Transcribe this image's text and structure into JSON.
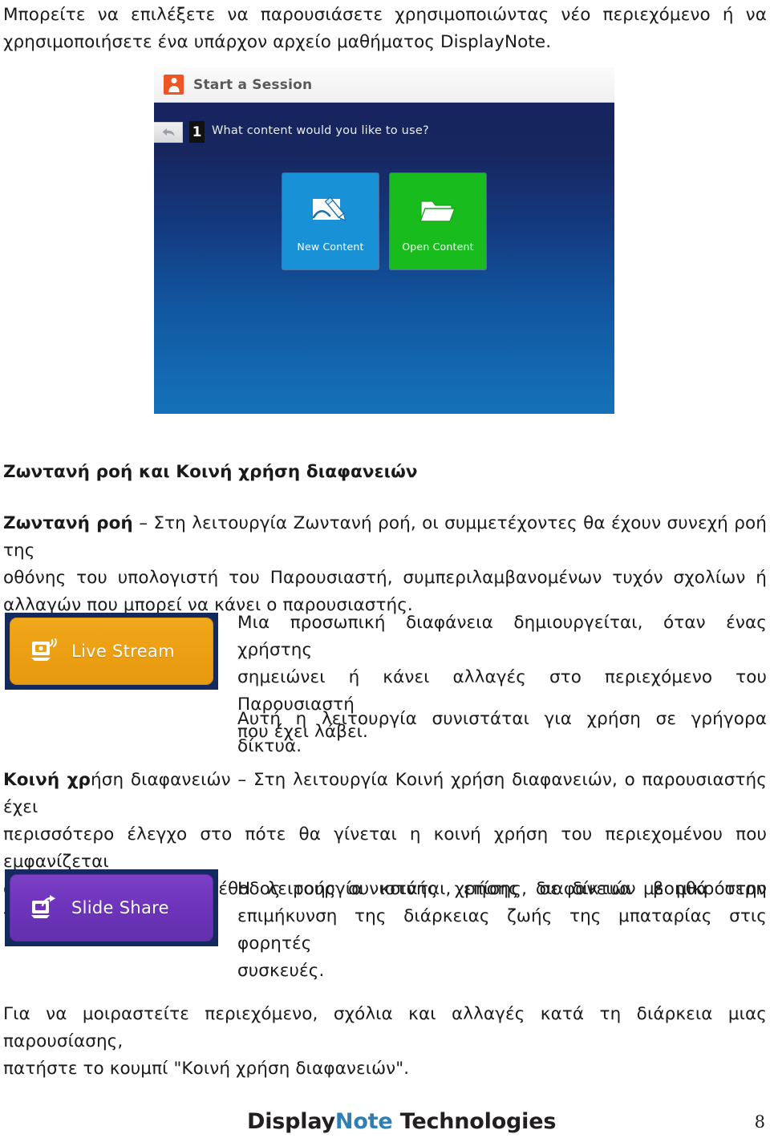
{
  "document": {
    "intro_line_1": "Μπορείτε να επιλέξετε να παρουσιάσετε χρησιμοποιώντας νέο περιεχόμενο ή να",
    "intro_line_2": "χρησιμοποιήσετε ένα υπάρχον αρχείο μαθήματος DisplayNote."
  },
  "screenshot": {
    "titlebar": {
      "title": "Start a Session",
      "app_icon": "user-badge-icon",
      "icon_color": "#ef5523"
    },
    "step": {
      "back_icon": "back-arrow-icon",
      "number": "1",
      "question": "What content would you like to use?"
    },
    "tiles": [
      {
        "label": "New Content",
        "icon": "whiteboard-pencil-icon",
        "color": "#1991d6"
      },
      {
        "label": "Open Content",
        "icon": "folder-open-icon",
        "color": "#18bd1d"
      }
    ],
    "background_gradient": [
      "#17245f",
      "#1571b8"
    ]
  },
  "section": {
    "heading": "Ζωντανή ροή και Κοινή χρήση διαφανειών"
  },
  "paragraphs": {
    "live_stream": {
      "bold_lead": "Ζωντανή ροή",
      "line_1_rest": " – Στη λειτουργία Ζωντανή ροή, οι συμμετέχοντες θα έχουν συνεχή ροή της",
      "line_2": "οθόνης του υπολογιστή του Παρουσιαστή, συμπεριλαμβανομένων τυχόν σχολίων ή",
      "line_3": "αλλαγών που μπορεί να κάνει ο παρουσιαστής."
    },
    "live_stream_right": {
      "line_1": "Μια προσωπική διαφάνεια δημιουργείται, όταν ένας χρήστης",
      "line_2": "σημειώνει ή κάνει αλλαγές στο περιεχόμενο του Παρουσιαστή",
      "line_3": "που έχει λάβει.",
      "note": "Αυτή η λειτουργία συνιστάται για χρήση σε γρήγορα δίκτυα."
    },
    "slide_share": {
      "bold_lead": "Κοινή χρ",
      "line_1_rest": "ήση διαφανειών – Στη λειτουργία Κοινή χρήση διαφανειών, ο παρουσιαστής έχει",
      "line_2": "περισσότερο έλεγχο στο πότε θα γίνεται η κοινή χρήση του περιεχομένου που εμφανίζεται",
      "line_3": "στην οθόνη.  Αυτή η μέθοδος ροής συνιστάται, επίσης, σε δίκτυα με μικρότερη ταχύτητα."
    },
    "slide_share_right": {
      "line_1": "Η λειτουργία κοινής χρήσης διαφανειών βοηθά στην",
      "line_2": "επιμήκυνση της διάρκειας ζωής της μπαταρίας στις φορητές",
      "line_3": "συσκευές."
    },
    "final": {
      "line_1": "Για να μοιραστείτε περιεχόμενο, σχόλια και αλλαγές κατά τη διάρκεια μιας παρουσίασης,",
      "line_2": "πατήστε το κουμπί \"Κοινή χρήση διαφανειών\"."
    }
  },
  "features": [
    {
      "label": "Live Stream",
      "icon": "broadcast-monitor-icon",
      "color": "#eda013"
    },
    {
      "label": "Slide Share",
      "icon": "laptop-share-icon",
      "color": "#6d34bb"
    }
  ],
  "footer": {
    "brand_part_1": "Display",
    "brand_part_2": "Note",
    "brand_part_3": " Technologies",
    "brand_accent_color": "#2f7fb5",
    "page_number": "8"
  }
}
